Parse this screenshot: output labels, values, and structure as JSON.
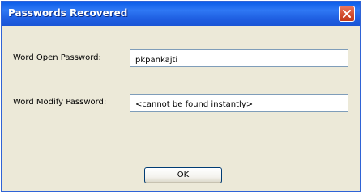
{
  "dialog": {
    "title": "Passwords Recovered"
  },
  "fields": {
    "open_label": "Word Open Password:",
    "open_value": "pkpankajti",
    "modify_label": "Word Modify Password:",
    "modify_value": "<cannot be found instantly>"
  },
  "buttons": {
    "ok_label": "OK"
  },
  "colors": {
    "titlebar_blue": "#1f5fe2",
    "close_red": "#d24d2f",
    "dialog_bg": "#ece9d8"
  },
  "icons": {
    "close": "close-icon"
  }
}
